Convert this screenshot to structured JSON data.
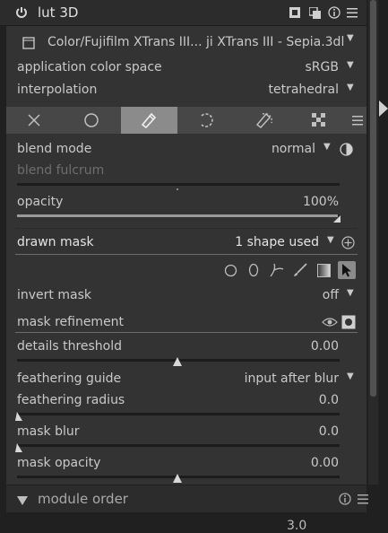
{
  "header": {
    "title": "lut 3D"
  },
  "file": {
    "label": "Color/Fujifilm XTrans III... ji XTrans III - Sepia.3dl"
  },
  "rows": {
    "app_color_space": {
      "label": "application color space",
      "value": "sRGB"
    },
    "interpolation": {
      "label": "interpolation",
      "value": "tetrahedral"
    },
    "blend_mode": {
      "label": "blend mode",
      "value": "normal"
    },
    "blend_fulcrum": {
      "label": "blend fulcrum"
    },
    "opacity": {
      "label": "opacity",
      "value": "100%"
    },
    "drawn_mask": {
      "label": "drawn mask",
      "value": "1 shape used"
    },
    "invert_mask": {
      "label": "invert mask",
      "value": "off"
    },
    "mask_refinement": {
      "label": "mask refinement"
    },
    "details_threshold": {
      "label": "details threshold",
      "value": "0.00"
    },
    "feathering_guide": {
      "label": "feathering guide",
      "value": "input after blur"
    },
    "feathering_radius": {
      "label": "feathering radius",
      "value": "0.0"
    },
    "mask_blur": {
      "label": "mask blur",
      "value": "0.0"
    },
    "mask_opacity": {
      "label": "mask opacity",
      "value": "0.00"
    }
  },
  "bottom": {
    "title": "module order"
  },
  "footer": {
    "partial_value": "3.0"
  },
  "icons": [
    "power-icon",
    "presets-icon",
    "multi-instance-icon",
    "reset-icon",
    "menu-icon",
    "file-icon",
    "off-icon",
    "uniform-icon",
    "drawn-mask-icon",
    "parametric-icon",
    "drawn-parametric-icon",
    "raster-icon",
    "tab-menu-icon",
    "blend-toggle-icon",
    "add-shape-icon",
    "circle-shape-icon",
    "ellipse-shape-icon",
    "path-shape-icon",
    "brush-shape-icon",
    "gradient-shape-icon",
    "edit-shapes-icon",
    "show-mask-icon",
    "expand-arrow-icon"
  ]
}
